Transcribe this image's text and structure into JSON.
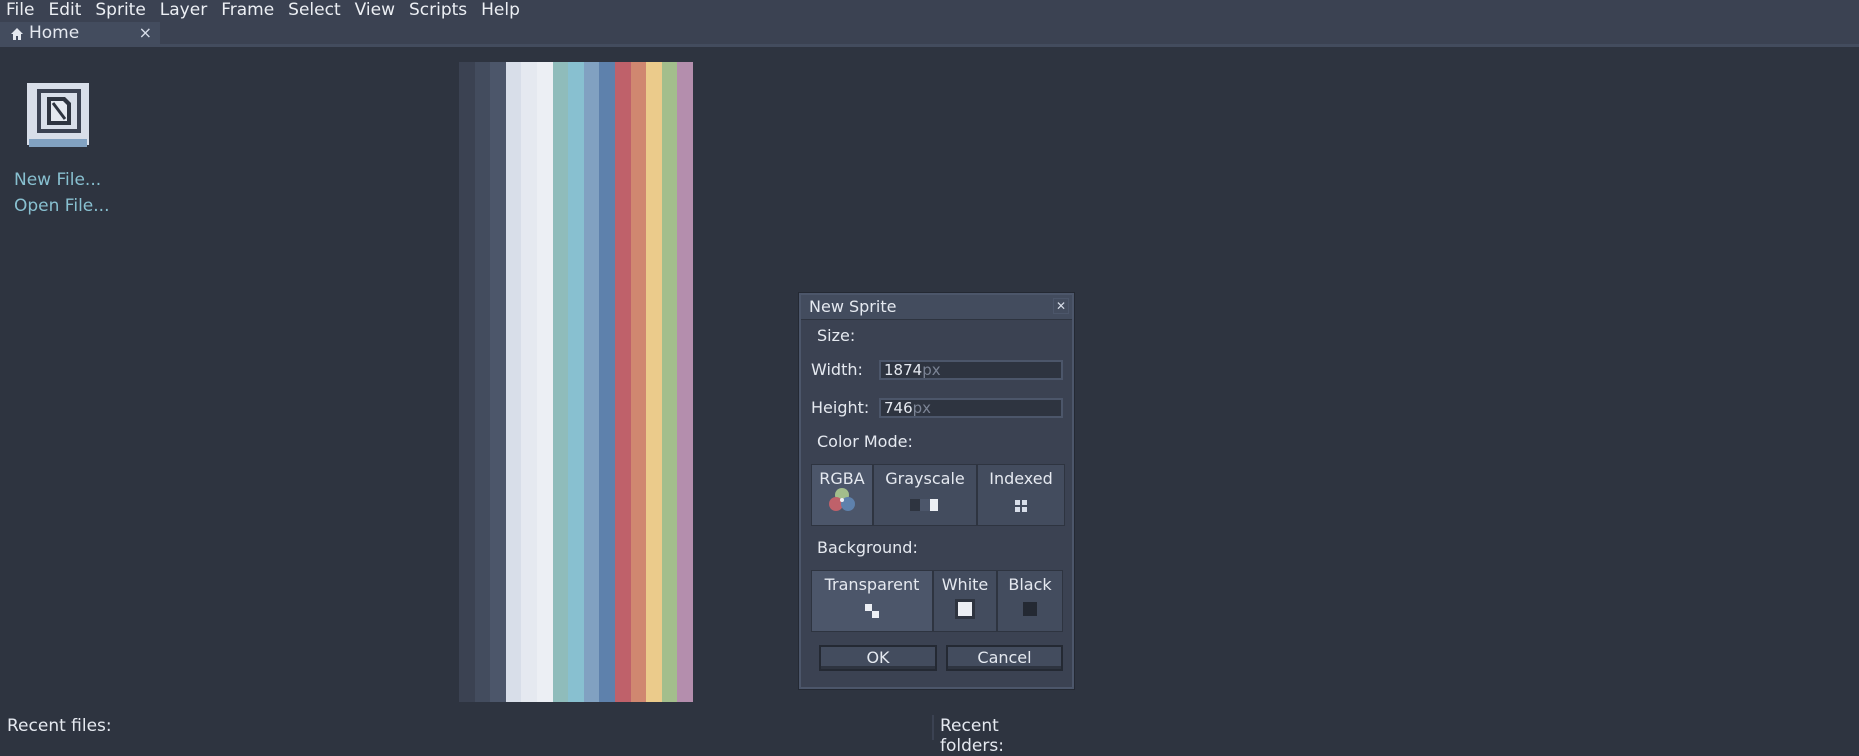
{
  "menubar": {
    "items": [
      "File",
      "Edit",
      "Sprite",
      "Layer",
      "Frame",
      "Select",
      "View",
      "Scripts",
      "Help"
    ]
  },
  "tabs": [
    {
      "label": "Home",
      "icon": "home-icon",
      "close": "×"
    }
  ],
  "home": {
    "new_file": "New File...",
    "open_file": "Open File...",
    "recent_files": "Recent files:",
    "recent_folders": "Recent folders:"
  },
  "palette": {
    "colors": [
      "#3b4252",
      "#434c5e",
      "#4c566a",
      "#d8dee9",
      "#e5e9f0",
      "#eceff4",
      "#8fbcbb",
      "#88c0d0",
      "#81a1c1",
      "#5e81ac",
      "#bf616a",
      "#d08770",
      "#ebcb8b",
      "#a3be8c",
      "#b48ead"
    ]
  },
  "dialog": {
    "title": "New Sprite",
    "close_icon": "close-icon",
    "size_label": "Size:",
    "width_label": "Width:",
    "width_value": "1874",
    "width_unit": "px",
    "height_label": "Height:",
    "height_value": "746",
    "height_unit": "px",
    "color_mode_label": "Color Mode:",
    "color_modes": [
      "RGBA",
      "Grayscale",
      "Indexed"
    ],
    "selected_color_mode": "RGBA",
    "background_label": "Background:",
    "backgrounds": [
      "Transparent",
      "White",
      "Black"
    ],
    "selected_background": "Transparent",
    "ok": "OK",
    "cancel": "Cancel"
  },
  "colors": {
    "background": "#2e3440",
    "panel": "#3b4252",
    "link": "#88c0d0"
  }
}
